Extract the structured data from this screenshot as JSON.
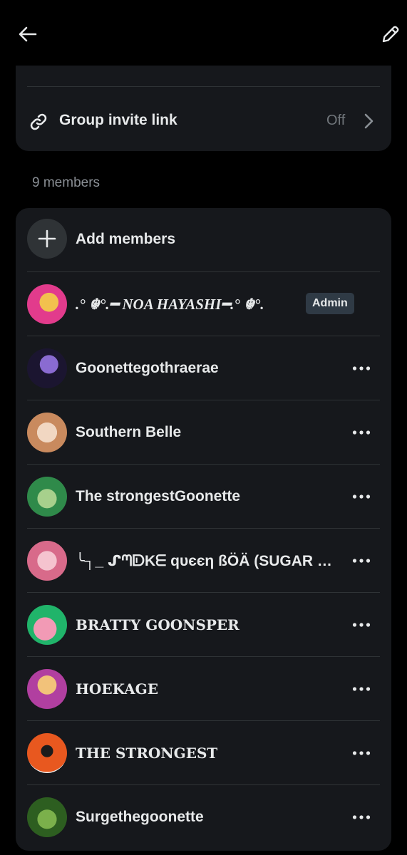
{
  "settings": {
    "invite_link_label": "Group invite link",
    "invite_link_value": "Off"
  },
  "members_count_label": "9 members",
  "add_members_label": "Add members",
  "admin_badge": "Admin",
  "members": [
    {
      "name": ".° ☬°.━ NOA HAYASHI━.° ☬°.",
      "admin": true,
      "avatar_colors": [
        "#e23b8c",
        "#f2c14e"
      ]
    },
    {
      "name": "Goonettegothraerae",
      "admin": false,
      "avatar_colors": [
        "#1b1530",
        "#8a6bd1"
      ]
    },
    {
      "name": "Southern Belle",
      "admin": false,
      "avatar_colors": [
        "#c98a5e",
        "#f1d7c2"
      ]
    },
    {
      "name": "The strongestGoonette",
      "admin": false,
      "avatar_colors": [
        "#2f8a4a",
        "#a7d08c"
      ]
    },
    {
      "name": "╰┐_ ᔑᘉᗟKᗴ qυєєη ßÖÄ (SUGAR ɱ…",
      "admin": false,
      "avatar_colors": [
        "#d86a8a",
        "#f5c3cf"
      ]
    },
    {
      "name": "BRATTY GOONSPER",
      "admin": false,
      "avatar_colors": [
        "#20b46a",
        "#f29ab5"
      ]
    },
    {
      "name": "HOEKAGE",
      "admin": false,
      "avatar_colors": [
        "#b13fa0",
        "#f2c27a"
      ]
    },
    {
      "name": "THE STRONGEST",
      "admin": false,
      "avatar_colors": [
        "#e8581f",
        "#1b1b1b"
      ]
    },
    {
      "name": "Surgethegoonette",
      "admin": false,
      "avatar_colors": [
        "#2d5e20",
        "#7bb04b"
      ]
    }
  ],
  "colors": {
    "background": "#000000",
    "card": "#16181c",
    "divider": "#2f3336",
    "text": "#e7e9ea",
    "muted": "#71767b"
  }
}
